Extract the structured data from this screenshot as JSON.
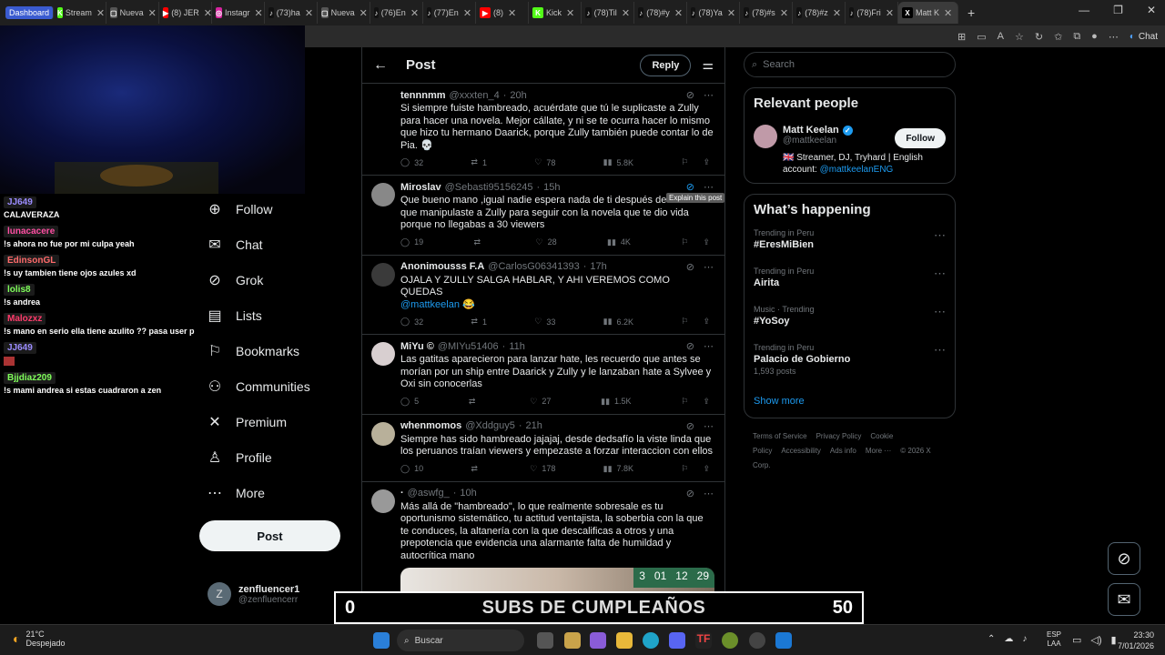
{
  "browser": {
    "tabs": [
      {
        "label": "Dashboard",
        "fav": "",
        "color": "#3a5bd0",
        "dash": true
      },
      {
        "label": "Stream",
        "fav": "K",
        "color": "#53fc18"
      },
      {
        "label": "Nueva",
        "fav": "▢",
        "color": "#555"
      },
      {
        "label": "(8) JER",
        "fav": "▶",
        "color": "#ff0000"
      },
      {
        "label": "Instagr",
        "fav": "◎",
        "color": "#d6249f"
      },
      {
        "label": "(73)ha",
        "fav": "♪",
        "color": "#111"
      },
      {
        "label": "Nueva",
        "fav": "▢",
        "color": "#555"
      },
      {
        "label": "(76)En",
        "fav": "♪",
        "color": "#111"
      },
      {
        "label": "(77)En",
        "fav": "♪",
        "color": "#111"
      },
      {
        "label": "(8)",
        "fav": "▶",
        "color": "#ff0000"
      },
      {
        "label": "Kick",
        "fav": "K",
        "color": "#53fc18"
      },
      {
        "label": "(78)Til",
        "fav": "♪",
        "color": "#111"
      },
      {
        "label": "(78)#y",
        "fav": "♪",
        "color": "#111"
      },
      {
        "label": "(78)Ya",
        "fav": "♪",
        "color": "#111"
      },
      {
        "label": "(78)#s",
        "fav": "♪",
        "color": "#111"
      },
      {
        "label": "(78)#z",
        "fav": "♪",
        "color": "#111"
      },
      {
        "label": "(78)Fri",
        "fav": "♪",
        "color": "#111"
      },
      {
        "label": "Matt K",
        "fav": "X",
        "color": "#000",
        "active": true
      }
    ],
    "chat_label": "Chat"
  },
  "stream_chat": [
    {
      "user": "JJ649",
      "color": "#9b8cff",
      "text": "CALAVERAZA"
    },
    {
      "user": "lunacacere",
      "color": "#ff4fa3",
      "text": "!s ahora no fue por mi culpa yeah"
    },
    {
      "user": "EdinsonGL",
      "color": "#ff6b6b",
      "text": "!s uy tambien tiene ojos azules xd"
    },
    {
      "user": "lolis8",
      "color": "#7fff5a",
      "text": "!s andrea"
    },
    {
      "user": "Malozxz",
      "color": "#ff3b6b",
      "text": "!s mano en serio ella tiene azulito ?? pasa user p"
    },
    {
      "user": "JJ649",
      "color": "#9b8cff",
      "text": ""
    },
    {
      "user": "Bjjdiaz209",
      "color": "#7fff5a",
      "text": "!s mami andrea si estas cuadraron a zen"
    }
  ],
  "nav": {
    "items": [
      {
        "label": "Follow",
        "icon": "person-add-icon",
        "glyph": "⊕"
      },
      {
        "label": "Chat",
        "icon": "mail-icon",
        "glyph": "✉"
      },
      {
        "label": "Grok",
        "icon": "grok-icon",
        "glyph": "⊘"
      },
      {
        "label": "Lists",
        "icon": "lists-icon",
        "glyph": "▤"
      },
      {
        "label": "Bookmarks",
        "icon": "bookmark-icon",
        "glyph": "⚐"
      },
      {
        "label": "Communities",
        "icon": "communities-icon",
        "glyph": "⚇"
      },
      {
        "label": "Premium",
        "icon": "x-premium-icon",
        "glyph": "✕"
      },
      {
        "label": "Profile",
        "icon": "profile-icon",
        "glyph": "♙"
      },
      {
        "label": "More",
        "icon": "more-circle-icon",
        "glyph": "⋯"
      }
    ],
    "post_label": "Post",
    "account": {
      "name": "zenfluencer1",
      "handle": "@zenfluencerr",
      "initial": "Z"
    }
  },
  "main": {
    "title": "Post",
    "reply_label": "Reply",
    "tooltip": "Explain this post",
    "posts": [
      {
        "name": "tennnmm",
        "handle": "@xxxten_4",
        "time": "20h",
        "avatar": "#000",
        "body": "Si siempre fuiste hambreado, acuérdate que tú le suplicaste a Zully para hacer una novela. Mejor cállate, y ni se te ocurra hacer lo mismo que hizo tu hermano Daarick, porque Zully también puede contar lo de Pia. 💀",
        "link": "",
        "replies": "32",
        "reposts": "1",
        "likes": "78",
        "views": "5.8K",
        "noavatar": true
      },
      {
        "name": "Miroslav",
        "handle": "@Sebasti95156245",
        "time": "15h",
        "avatar": "#888",
        "body": "Que bueno mano ,igual nadie espera nada de ti después de habe... que manipulaste a Zully para seguir con la novela que te dio vida porque no llegabas a 30 viewers",
        "link": "",
        "replies": "19",
        "reposts": "",
        "likes": "28",
        "views": "4K"
      },
      {
        "name": "Anonimousss F.A",
        "handle": "@CarlosG06341393",
        "time": "17h",
        "avatar": "#3a3a3a",
        "body": "OJALA Y ZULLY SALGA HABLAR, Y AHI VEREMOS COMO QUEDAS",
        "link": "@mattkeelan 😂",
        "replies": "32",
        "reposts": "1",
        "likes": "33",
        "views": "6.2K"
      },
      {
        "name": "MiYu ©",
        "handle": "@MIYu51406",
        "time": "11h",
        "avatar": "#d8cfd0",
        "body": "Las gatitas aparecieron para lanzar hate, les recuerdo que antes se morían por un ship entre Daarick y Zully y le lanzaban hate a Sylvee y Oxi sin conocerlas",
        "link": "",
        "replies": "5",
        "reposts": "",
        "likes": "27",
        "views": "1.5K"
      },
      {
        "name": "whenmomos",
        "handle": "@Xddguy5",
        "time": "21h",
        "avatar": "#b8b09a",
        "body": "Siempre has sido hambreado jajajaj, desde dedsafío la viste linda que los peruanos traían viewers y empezaste a forzar interaccion con ellos",
        "link": "",
        "replies": "10",
        "reposts": "",
        "likes": "178",
        "views": "7.8K"
      },
      {
        "name": "·",
        "handle": "@aswfg_",
        "time": "10h",
        "avatar": "#999",
        "body": "Más allá de \"hambreado\", lo que realmente sobresale es tu oportunismo sistemático, tu actitud ventajista, la soberbia con la que te conduces, la altanería con la que descalificas a otros y una prepotencia que evidencia una alarmante falta de humildad y autocrítica mano",
        "link": "",
        "replies": "",
        "reposts": "",
        "likes": "",
        "views": "",
        "media": true
      }
    ],
    "media_digits": [
      "3",
      "01",
      "12",
      "29"
    ]
  },
  "right": {
    "search_placeholder": "Search",
    "people_title": "Relevant people",
    "person": {
      "name": "Matt Keelan",
      "handle": "@mattkeelan",
      "bio": "🇬🇧 Streamer, DJ, Tryhard | English account:",
      "bio_link": "@mattkeelanENG",
      "follow_label": "Follow"
    },
    "happening_title": "What’s happening",
    "trends": [
      {
        "context": "Trending in Peru",
        "name": "#EresMiBien",
        "count": ""
      },
      {
        "context": "Trending in Peru",
        "name": "Airita",
        "count": ""
      },
      {
        "context": "Music · Trending",
        "name": "#YoSoy",
        "count": ""
      },
      {
        "context": "Trending in Peru",
        "name": "Palacio de Gobierno",
        "count": "1,593 posts"
      }
    ],
    "show_more": "Show more",
    "footer": [
      "Terms of Service",
      "Privacy Policy",
      "Cookie Policy",
      "Accessibility",
      "Ads info",
      "More ···",
      "© 2026 X Corp."
    ]
  },
  "subs": {
    "left": "0",
    "text": "SUBS DE CUMPLEAÑOS",
    "right": "50"
  },
  "taskbar": {
    "temp": "21°C",
    "condition": "Despejado",
    "search": "Buscar",
    "lang_top": "ESP",
    "lang_bottom": "LAA",
    "time": "23:30",
    "date": "7/01/2026"
  }
}
